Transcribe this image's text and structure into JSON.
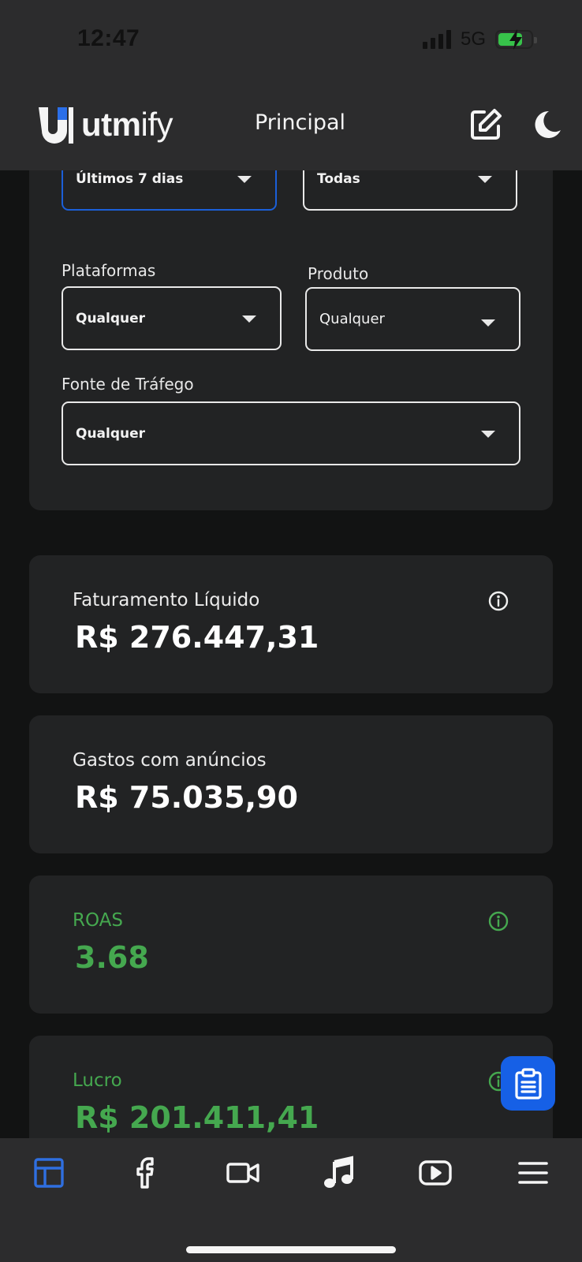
{
  "status_bar": {
    "time": "12:47",
    "network": "5G",
    "battery_level": 0.75,
    "colors": {
      "battery": "#37c24a"
    }
  },
  "header": {
    "logo_text_bold": "utm",
    "logo_text_light": "ify",
    "title": "Principal",
    "icons": [
      "edit-icon",
      "moon-icon"
    ]
  },
  "filters": {
    "period": {
      "value": "Últimos 7 dias"
    },
    "account": {
      "value": "Todas"
    },
    "platforms": {
      "label": "Plataformas",
      "value": "Qualquer"
    },
    "product": {
      "label": "Produto",
      "value": "Qualquer"
    },
    "traffic_source": {
      "label": "Fonte de Tráfego",
      "value": "Qualquer"
    }
  },
  "metrics": [
    {
      "label": "Faturamento Líquido",
      "value": "R$ 276.447,31",
      "info": true
    },
    {
      "label": "Gastos com anúncios",
      "value": "R$ 75.035,90",
      "info": false
    },
    {
      "label": "ROAS",
      "value": "3.68",
      "info": true,
      "color": "#45a84f"
    },
    {
      "label": "Lucro",
      "value": "R$ 201.411,41",
      "info": true,
      "color": "#45a84f"
    }
  ],
  "bottom_nav": {
    "items": [
      "dashboard-icon",
      "facebook-icon",
      "video-camera-icon",
      "music-note-icon",
      "youtube-icon",
      "menu-icon"
    ],
    "active": "dashboard-icon",
    "colors": {
      "active": "#2f6fe0",
      "inactive": "#f5f5f5"
    }
  },
  "fab": {
    "icon": "clipboard-icon",
    "color": "#1660e6"
  }
}
